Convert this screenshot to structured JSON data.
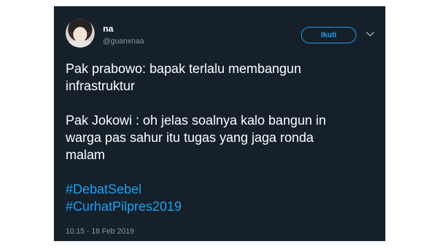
{
  "tweet": {
    "display_name": "na",
    "handle": "@guanxnaa",
    "follow_label": "Ikuti",
    "lines": {
      "l1": "Pak prabowo: bapak terlalu membangun",
      "l2": "infrastruktur",
      "l3": "Pak Jokowi : oh jelas soalnya kalo bangun in",
      "l4": "warga pas sahur itu tugas yang jaga ronda",
      "l5": "malam"
    },
    "hashtags": [
      "#DebatSebel",
      "#CurhatPilpres2019"
    ],
    "timestamp": "10.15 - 18 Feb 2019"
  },
  "icons": {
    "more": "chevron-down-icon"
  },
  "colors": {
    "card_bg": "#15202b",
    "accent": "#1da1f2",
    "secondary_text": "#8899a6",
    "text": "#ffffff"
  }
}
